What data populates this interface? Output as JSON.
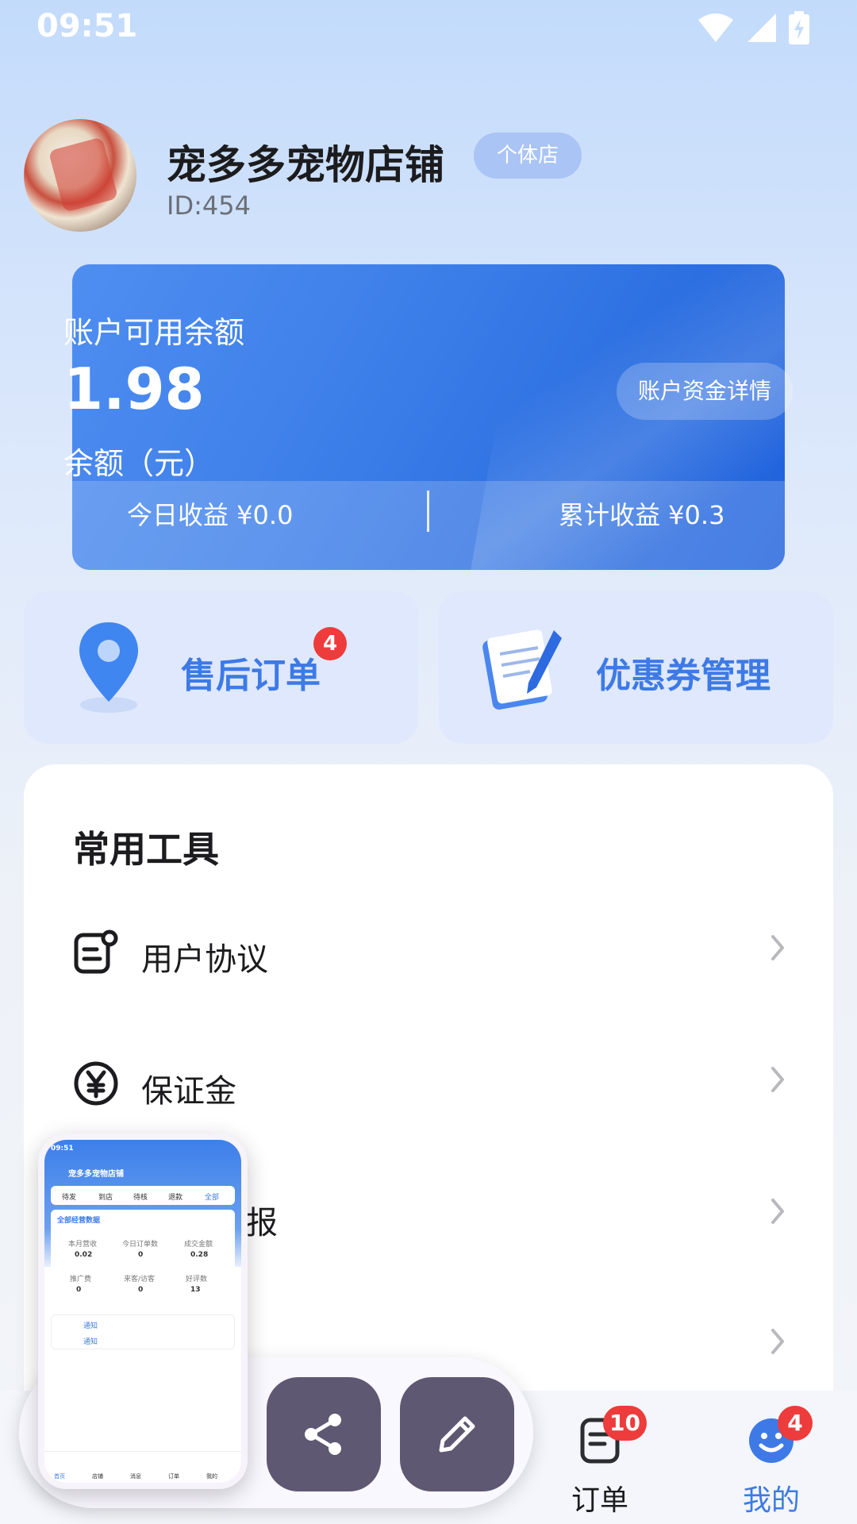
{
  "status_bar": {
    "time": "09:51",
    "icons": [
      "wifi-icon",
      "signal-icon",
      "battery-charging-icon"
    ]
  },
  "shop": {
    "name": "宠多多宠物店铺",
    "badge": "个体店",
    "id": "ID:454"
  },
  "balance": {
    "label": "账户可用余额",
    "value": "1.98",
    "unit_label": "余额（元）",
    "detail_button": "账户资金详情",
    "today_income": "今日收益 ¥0.0",
    "total_income": "累计收益 ¥0.3"
  },
  "quick_actions": [
    {
      "label": "售后订单",
      "badge": "4",
      "icon": "location-pin-icon"
    },
    {
      "label": "优惠券管理",
      "icon": "notepad-pen-icon"
    }
  ],
  "tools": {
    "title": "常用工具",
    "items": [
      {
        "label": "用户协议",
        "icon": "document-user-icon"
      },
      {
        "label": "保证金",
        "icon": "yen-circle-icon"
      },
      {
        "label": "报",
        "icon": "report-icon"
      },
      {
        "label": "",
        "icon": ""
      }
    ]
  },
  "bottom_nav": [
    {
      "label": "订单",
      "badge": "10",
      "icon": "order-list-icon",
      "active": false
    },
    {
      "label": "我的",
      "badge": "4",
      "icon": "smile-user-icon",
      "active": true
    }
  ],
  "floating": {
    "buttons": [
      "share-icon",
      "edit-pencil-icon"
    ]
  },
  "mini_preview": {
    "time": "09:51",
    "shop_name": "宠多多宠物店铺",
    "tabs": [
      "待发",
      "到店",
      "待核",
      "退款",
      "全部"
    ],
    "section_title": "全部经营数据",
    "stats": [
      {
        "label": "本月营收",
        "value": "0.02"
      },
      {
        "label": "今日订单数",
        "value": "0"
      },
      {
        "label": "成交金额",
        "value": "0.28"
      },
      {
        "label": "推广费",
        "value": "0"
      },
      {
        "label": "来客/访客",
        "value": "0"
      },
      {
        "label": "好评数",
        "value": "13"
      }
    ],
    "notices": [
      "通知",
      "通知"
    ],
    "nav": [
      "首页",
      "店铺",
      "消息",
      "订单",
      "我的"
    ]
  },
  "colors": {
    "accent": "#3d7ae6",
    "badge": "#ee3b3b",
    "fab": "#5e5872"
  }
}
